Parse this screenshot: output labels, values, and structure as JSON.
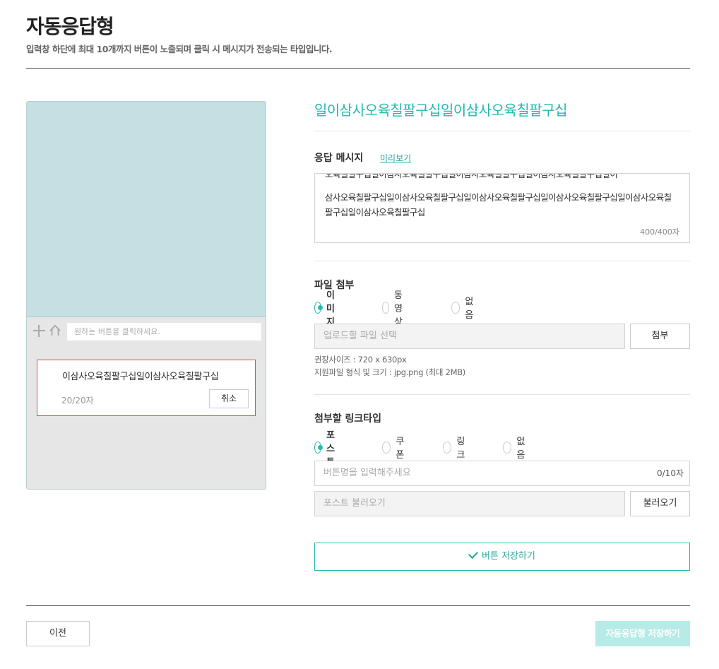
{
  "header": {
    "title": "자동응답형",
    "description": "입력창 하단에 최대 10개까지 버튼이 노출되며 클릭 시 메시지가 전송되는 타입입니다."
  },
  "preview": {
    "chat_input_placeholder": "원하는 버튼을 클릭하세요.",
    "card_text": "이삼사오육칠팔구십일이삼사오육칠팔구십",
    "card_count": "20/20자",
    "cancel_label": "취소"
  },
  "form": {
    "title": "일이삼사오육칠팔구십일이삼사오육칠팔구십",
    "response": {
      "label": "응답 메시지",
      "preview_link": "미리보기",
      "text_top": "오육칠팔구십일이삼사오육칠팔구십일이삼사오육칠팔구십일이삼사오육칠팔구십일이",
      "text_rest": "삼사오육칠팔구십일이삼사오육칠팔구십일이삼사오육칠팔구십일이삼사오육칠팔구십일이삼사오육칠팔구십일이삼사오육칠팔구십",
      "count": "400/400자"
    },
    "attachment": {
      "label": "파일 첨부",
      "options": [
        "이미지",
        "동영상",
        "없음"
      ],
      "selected": "이미지",
      "file_placeholder": "업로드할 파일 선택",
      "attach_button": "첨부",
      "hint_size": "권장사이즈 : 720 x 630px",
      "hint_format": "지원파일 형식 및 크기 : jpg.png (최대 2MB)"
    },
    "link_type": {
      "label": "첨부할 링크타입",
      "options": [
        "포스트",
        "쿠폰",
        "링크",
        "없음"
      ],
      "selected": "포스트",
      "button_name_placeholder": "버튼명을 입력해주세요",
      "button_name_count": "0/10자",
      "post_placeholder": "포스트 불러오기",
      "load_button": "불러오기"
    },
    "save_button": "버튼 저장하기"
  },
  "footer": {
    "prev_button": "이전",
    "final_button": "자동응답형 저장하기"
  },
  "colors": {
    "accent": "#22b8b0",
    "preview_screen": "#c4e0e3",
    "final_button_bg": "#b6ebe7",
    "error_border": "#e04848"
  }
}
